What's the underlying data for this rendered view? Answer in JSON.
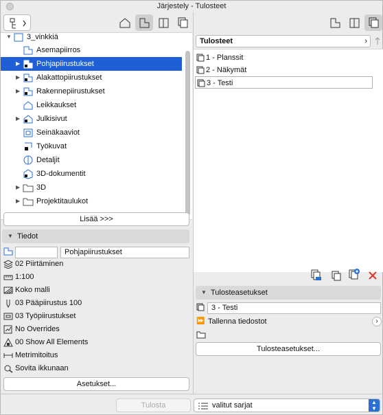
{
  "window": {
    "title": "Järjestely - Tulosteet"
  },
  "left": {
    "tree": {
      "root_label": "3_vinkkiä",
      "items": [
        {
          "label": "Asemapiirros",
          "expandable": false,
          "selected": false
        },
        {
          "label": "Pohjapiirustukset",
          "expandable": true,
          "selected": true
        },
        {
          "label": "Alakattopiirustukset",
          "expandable": true,
          "selected": false
        },
        {
          "label": "Rakennepiirustukset",
          "expandable": true,
          "selected": false
        },
        {
          "label": "Leikkaukset",
          "expandable": false,
          "selected": false
        },
        {
          "label": "Julkisivut",
          "expandable": true,
          "selected": false
        },
        {
          "label": "Seinäkaaviot",
          "expandable": false,
          "selected": false
        },
        {
          "label": "Työkuvat",
          "expandable": false,
          "selected": false
        },
        {
          "label": "Detaljit",
          "expandable": false,
          "selected": false
        },
        {
          "label": "3D-dokumentit",
          "expandable": false,
          "selected": false
        },
        {
          "label": "3D",
          "expandable": true,
          "selected": false
        },
        {
          "label": "Projektitaulukot",
          "expandable": true,
          "selected": false
        }
      ]
    },
    "more_button": "Lisää >>>",
    "info": {
      "header": "Tiedot",
      "id_value": "",
      "name_value": "Pohjapiirustukset",
      "rows": [
        {
          "icon": "layers-icon",
          "label": "02 Piirtäminen"
        },
        {
          "icon": "scale-icon",
          "label": "1:100"
        },
        {
          "icon": "model-icon",
          "label": "Koko malli"
        },
        {
          "icon": "pen-icon",
          "label": "03 Pääpiirustus 100"
        },
        {
          "icon": "penset-icon",
          "label": "03 Työpiirustukset"
        },
        {
          "icon": "overrides-icon",
          "label": "No Overrides"
        },
        {
          "icon": "elements-icon",
          "label": "00 Show All Elements"
        },
        {
          "icon": "dimension-icon",
          "label": "Metrimitoitus"
        },
        {
          "icon": "zoom-icon",
          "label": "Sovita ikkunaan"
        }
      ],
      "settings_button": "Asetukset..."
    }
  },
  "right": {
    "header": "Tulosteet",
    "items": [
      {
        "label": "1 - Planssit",
        "boxed": false
      },
      {
        "label": "2 - Näkymät",
        "boxed": false
      },
      {
        "label": "3 - Testi",
        "boxed": true
      }
    ],
    "output_settings": {
      "header": "Tulosteasetukset",
      "name_value": "3 - Testi",
      "save_files_label": "Tallenna tiedostot",
      "settings_button": "Tulosteasetukset..."
    }
  },
  "bottom": {
    "print_button": "Tulosta",
    "set_select": "valitut sarjat"
  },
  "colors": {
    "selection": "#1f5fd6",
    "delete": "#e0332b"
  }
}
